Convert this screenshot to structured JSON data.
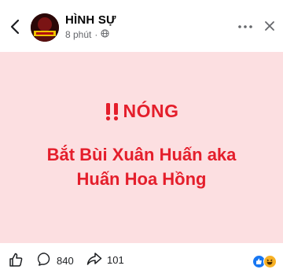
{
  "header": {
    "page_name": "HÌNH SỰ",
    "timestamp": "8 phút",
    "separator": "·",
    "icons": [
      "back-arrow-icon",
      "globe-icon",
      "more-icon",
      "close-icon"
    ]
  },
  "post": {
    "headline": "NÓNG",
    "headline_icon": "double-exclamation-icon",
    "body_lines": [
      "Bắt Bùi Xuân Huấn aka",
      "Huấn Hoa Hồng"
    ],
    "background_color": "#fcdfe1",
    "text_color": "#e41e2b"
  },
  "actions": {
    "comment_count": "840",
    "share_count": "101",
    "reaction_icons": [
      "like-reaction-icon",
      "haha-reaction-icon"
    ]
  }
}
